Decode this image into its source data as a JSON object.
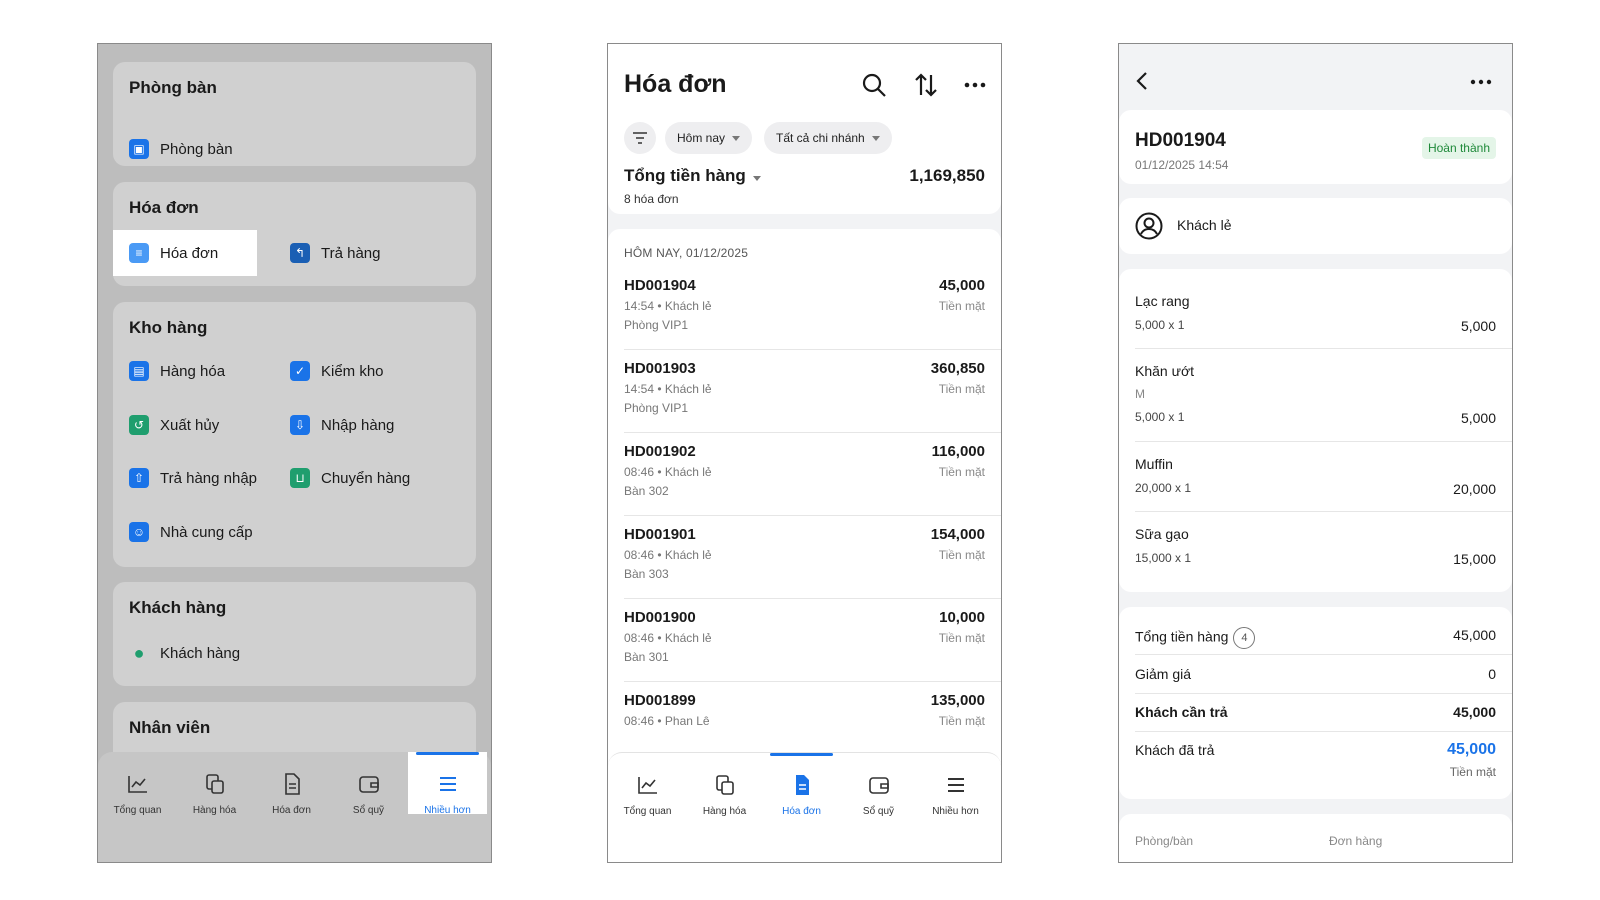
{
  "menu": {
    "sections": [
      {
        "title": "Phòng bàn",
        "items": [
          "Phòng bàn"
        ]
      },
      {
        "title": "Hóa đơn",
        "items": [
          "Hóa đơn",
          "Trả hàng"
        ]
      },
      {
        "title": "Kho hàng",
        "items": [
          "Hàng hóa",
          "Kiểm kho",
          "Xuất hủy",
          "Nhập hàng",
          "Trả hàng nhập",
          "Chuyển hàng",
          "Nhà cung cấp"
        ]
      },
      {
        "title": "Khách hàng",
        "items": [
          "Khách hàng"
        ]
      },
      {
        "title": "Nhân viên",
        "items": []
      }
    ]
  },
  "tabs": [
    "Tổng quan",
    "Hàng hóa",
    "Hóa đơn",
    "Sổ quỹ",
    "Nhiều hơn"
  ],
  "invoices": {
    "title": "Hóa đơn",
    "filters": {
      "date": "Hôm nay",
      "branch": "Tất cả chi nhánh"
    },
    "summary_label": "Tổng tiền hàng",
    "summary_count": "8 hóa đơn",
    "summary_total": "1,169,850",
    "date_header": "HÔM NAY, 01/12/2025",
    "rows": [
      {
        "code": "HD001904",
        "amount": "45,000",
        "meta": "14:54 • Khách lẻ",
        "payment": "Tiền mặt",
        "place": "Phòng VIP1"
      },
      {
        "code": "HD001903",
        "amount": "360,850",
        "meta": "14:54 • Khách lẻ",
        "payment": "Tiền mặt",
        "place": "Phòng VIP1"
      },
      {
        "code": "HD001902",
        "amount": "116,000",
        "meta": "08:46 • Khách lẻ",
        "payment": "Tiền mặt",
        "place": "Bàn 302"
      },
      {
        "code": "HD001901",
        "amount": "154,000",
        "meta": "08:46 • Khách lẻ",
        "payment": "Tiền mặt",
        "place": "Bàn 303"
      },
      {
        "code": "HD001900",
        "amount": "10,000",
        "meta": "08:46 • Khách lẻ",
        "payment": "Tiền mặt",
        "place": "Bàn 301"
      },
      {
        "code": "HD001899",
        "amount": "135,000",
        "meta": "08:46 • Phan Lê",
        "payment": "Tiền mặt",
        "place": ""
      }
    ]
  },
  "detail": {
    "code": "HD001904",
    "datetime": "01/12/2025 14:54",
    "status": "Hoàn thành",
    "customer": "Khách lẻ",
    "items": [
      {
        "name": "Lạc rang",
        "variant": "",
        "qty": "5,000   x 1",
        "total": "5,000"
      },
      {
        "name": "Khăn ướt",
        "variant": "M",
        "qty": "5,000   x 1",
        "total": "5,000"
      },
      {
        "name": "Muffin",
        "variant": "",
        "qty": "20,000   x 1",
        "total": "20,000"
      },
      {
        "name": "Sữa gạo",
        "variant": "",
        "qty": "15,000   x 1",
        "total": "15,000"
      }
    ],
    "summary": {
      "subtotal_label": "Tổng tiền hàng",
      "item_count": "4",
      "subtotal": "45,000",
      "discount_label": "Giảm giá",
      "discount": "0",
      "due_label": "Khách cần trả",
      "due": "45,000",
      "paid_label": "Khách đã trả",
      "paid": "45,000",
      "paid_method": "Tiền mặt"
    },
    "footer_labels": [
      "Phòng/bàn",
      "Đơn hàng"
    ]
  },
  "colors": {
    "accent": "#1a73e8",
    "success": "#1f8a3a"
  }
}
